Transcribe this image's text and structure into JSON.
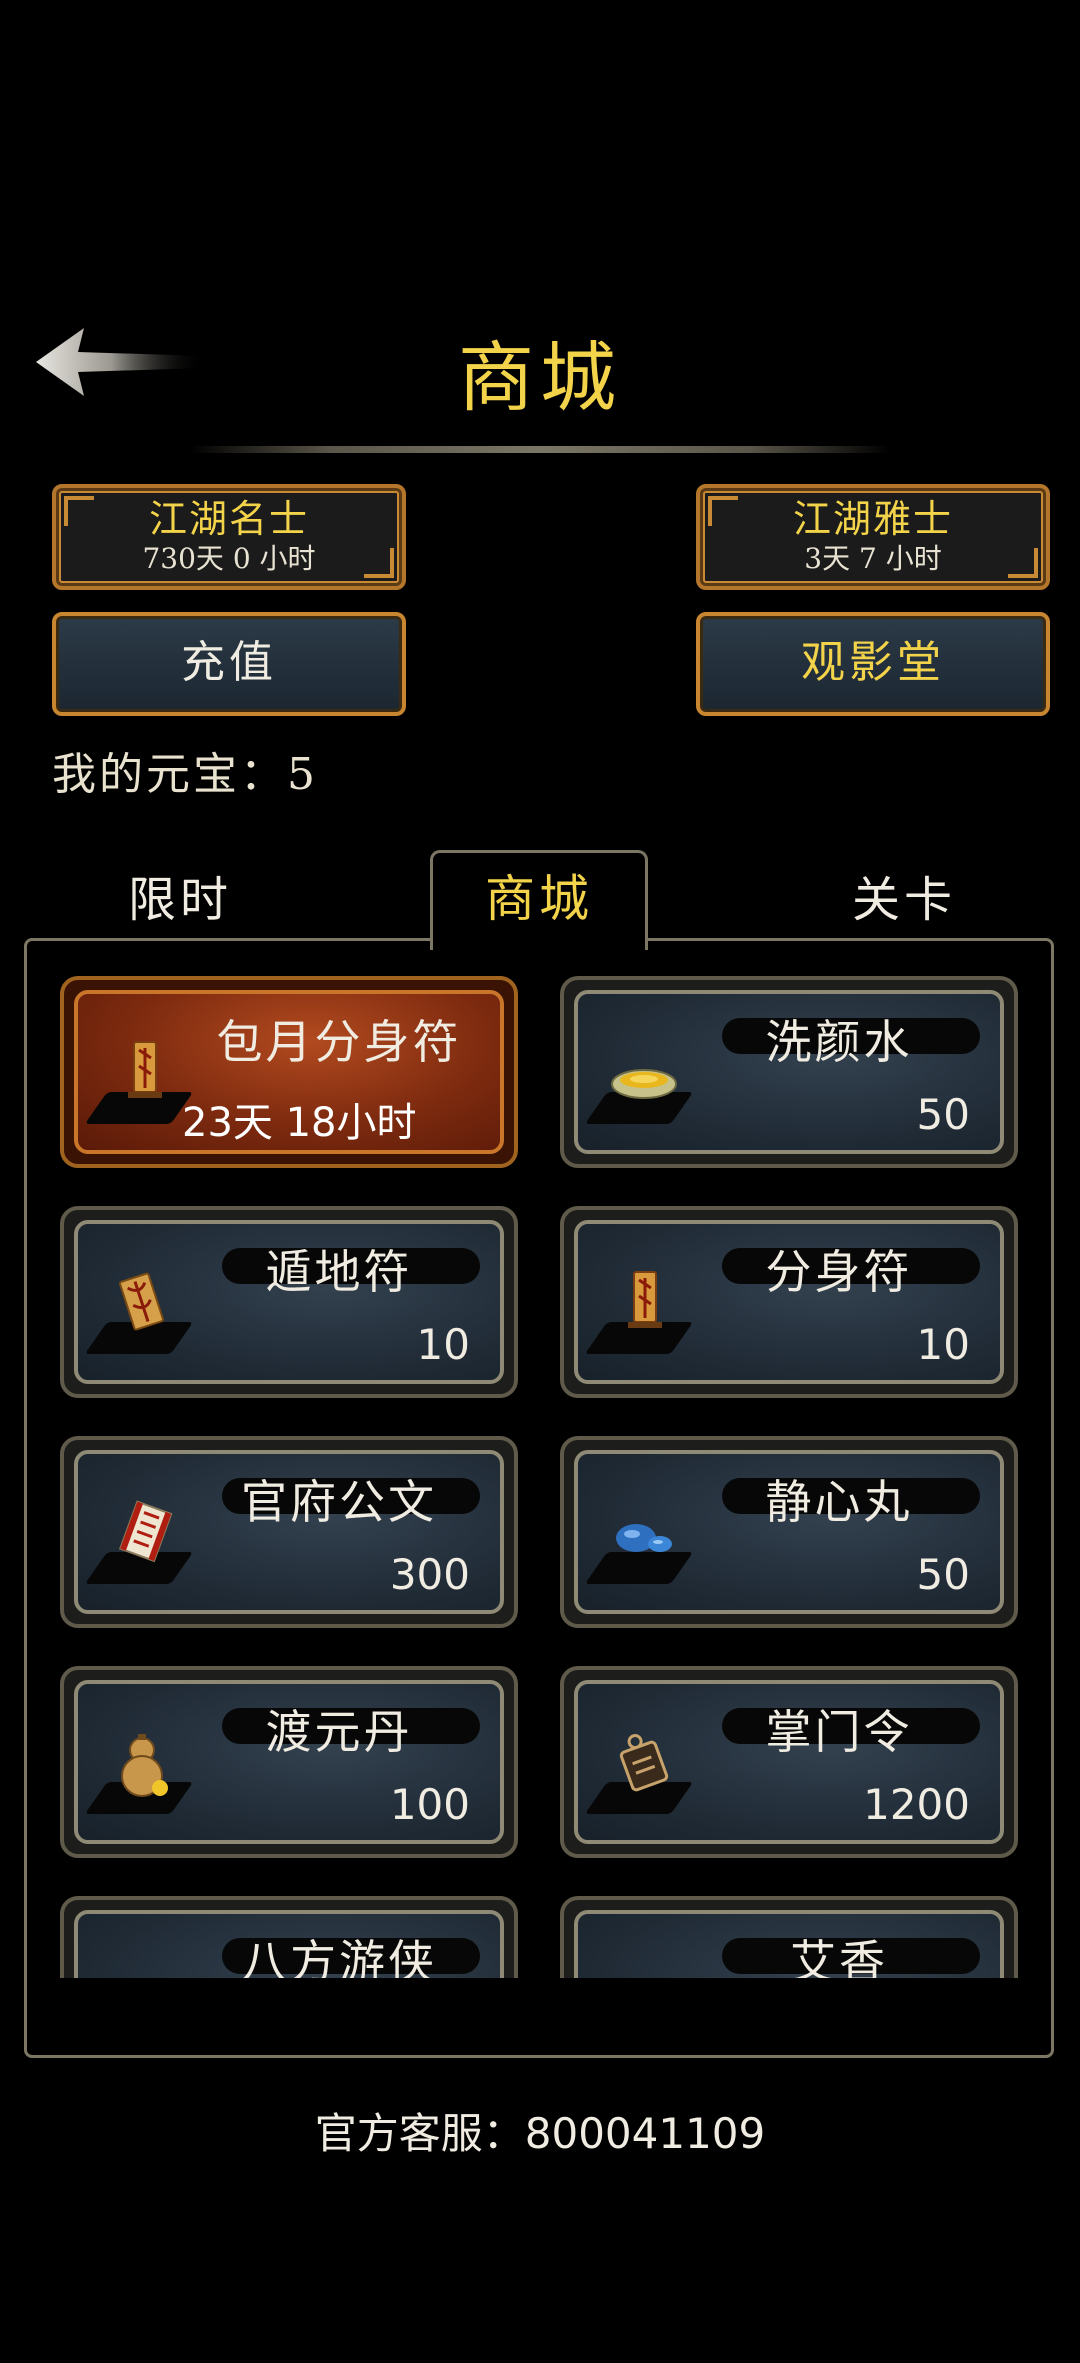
{
  "header": {
    "title": "商城",
    "back_icon": "back-arrow-icon"
  },
  "vip": [
    {
      "name": "江湖名士",
      "time": "730天 0 小时"
    },
    {
      "name": "江湖雅士",
      "time": "3天 7 小时"
    }
  ],
  "actions": {
    "recharge": "充值",
    "cinema": "观影堂"
  },
  "wallet": {
    "label": "我的元宝：5"
  },
  "tabs": {
    "left": "限时",
    "active": "商城",
    "right": "关卡"
  },
  "items": [
    {
      "name": "包月分身符",
      "timer": "23天 18小时",
      "icon": "talisman-icon",
      "special": true
    },
    {
      "name": "洗颜水",
      "price": "50",
      "icon": "bowl-icon"
    },
    {
      "name": "遁地符",
      "price": "10",
      "icon": "earth-talisman-icon"
    },
    {
      "name": "分身符",
      "price": "10",
      "icon": "clone-talisman-icon"
    },
    {
      "name": "官府公文",
      "price": "300",
      "icon": "scroll-icon"
    },
    {
      "name": "静心丸",
      "price": "50",
      "icon": "pill-icon"
    },
    {
      "name": "渡元丹",
      "price": "100",
      "icon": "gourd-icon"
    },
    {
      "name": "掌门令",
      "price": "1200",
      "icon": "token-icon"
    },
    {
      "name": "八方游侠",
      "price": "",
      "icon": "hero-icon"
    },
    {
      "name": "艾香",
      "price": "",
      "icon": "incense-icon"
    }
  ],
  "footer": {
    "service": "官方客服：800041109"
  },
  "colors": {
    "gold": "#f2d34a",
    "border": "#c7862f",
    "card_special": "#7d2a0f"
  }
}
